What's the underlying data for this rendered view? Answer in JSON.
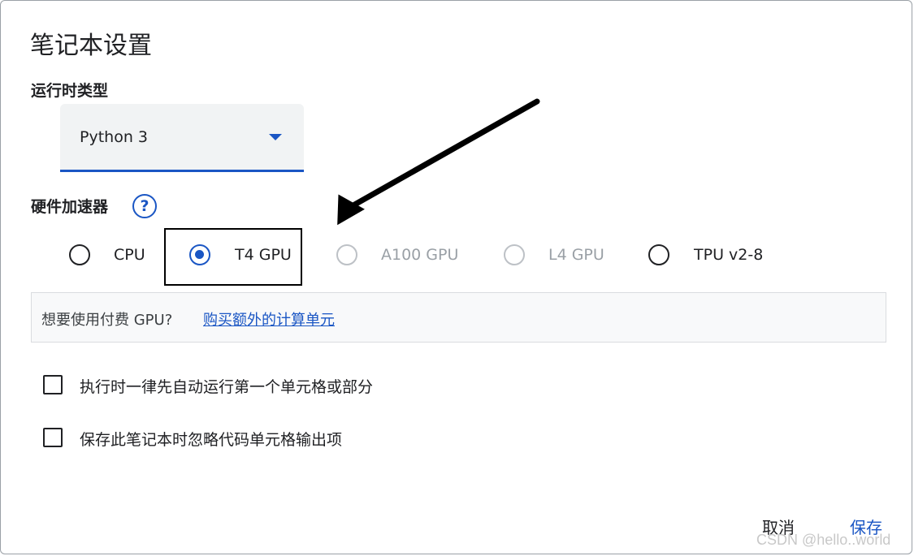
{
  "dialog": {
    "title": "笔记本设置"
  },
  "runtime": {
    "label": "运行时类型",
    "selected": "Python 3"
  },
  "hardware": {
    "label": "硬件加速器",
    "help_icon": "?",
    "options": [
      {
        "label": "CPU",
        "state": "enabled",
        "checked": false
      },
      {
        "label": "T4 GPU",
        "state": "enabled",
        "checked": true
      },
      {
        "label": "A100 GPU",
        "state": "disabled",
        "checked": false
      },
      {
        "label": "L4 GPU",
        "state": "disabled",
        "checked": false
      },
      {
        "label": "TPU v2-8",
        "state": "enabled",
        "checked": false
      }
    ]
  },
  "banner": {
    "text": "想要使用付费 GPU?",
    "link": "购买额外的计算单元"
  },
  "checkboxes": [
    {
      "label": "执行时一律先自动运行第一个单元格或部分",
      "checked": false
    },
    {
      "label": "保存此笔记本时忽略代码单元格输出项",
      "checked": false
    }
  ],
  "buttons": {
    "cancel": "取消",
    "save": "保存"
  },
  "watermark": "CSDN @hello..world",
  "colors": {
    "accent": "#1a56c4",
    "disabled": "#9aa0a6",
    "banner_bg": "#f8f9fa",
    "select_bg": "#f1f3f4"
  }
}
